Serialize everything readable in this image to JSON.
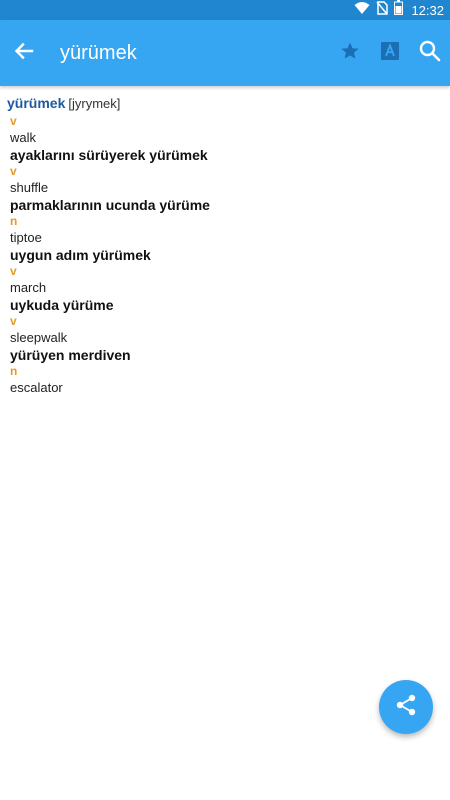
{
  "status_bar": {
    "time": "12:32",
    "icons": [
      "wifi-icon",
      "no-sim-icon",
      "battery-icon"
    ]
  },
  "app_bar": {
    "title": "yürümek",
    "back_icon": "arrow-back-icon",
    "actions": [
      "star-icon",
      "translate-icon",
      "search-icon"
    ]
  },
  "headword": {
    "word": "yürümek",
    "pronunciation": "[jyrymek]"
  },
  "entries": [
    {
      "pos": "v",
      "translation": "walk"
    },
    {
      "phrase": "ayaklarını sürüyerek yürümek",
      "pos": "v",
      "translation": "shuffle"
    },
    {
      "phrase": "parmaklarının ucunda yürüme",
      "pos": "n",
      "translation": "tiptoe"
    },
    {
      "phrase": "uygun adım yürümek",
      "pos": "v",
      "translation": "march"
    },
    {
      "phrase": "uykuda yürüme",
      "pos": "v",
      "translation": "sleepwalk"
    },
    {
      "phrase": "yürüyen merdiven",
      "pos": "n",
      "translation": "escalator"
    }
  ],
  "fab": {
    "icon": "share-icon"
  },
  "colors": {
    "status_bar": "#1f86cf",
    "app_bar": "#36a6f3",
    "headword": "#1e5a9e",
    "pos": "#e59a2a"
  }
}
